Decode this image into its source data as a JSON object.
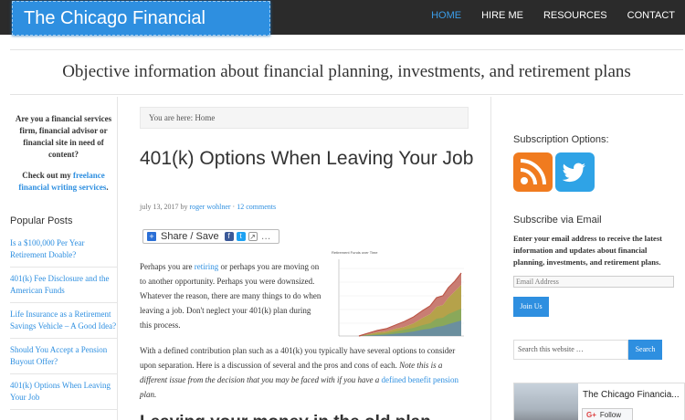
{
  "header": {
    "logo": "The Chicago Financial Planner",
    "nav": [
      "HOME",
      "HIRE ME",
      "RESOURCES",
      "CONTACT"
    ],
    "active_nav": "HOME",
    "tagline": "Objective information about financial planning, investments, and retirement plans"
  },
  "left_sidebar": {
    "promo_text": "Are you a financial services firm, financial advisor or financial site in need of content?",
    "promo_cta_prefix": "Check out my",
    "promo_cta_link": "freelance financial writing services",
    "promo_cta_suffix": ".",
    "popular_title": "Popular Posts",
    "popular_posts": [
      "Is a $100,000 Per Year Retirement Doable?",
      "401(k) Fee Disclosure and the American Funds",
      "Life Insurance as a Retirement Savings Vehicle – A Good Idea?",
      "Should You Accept a Pension Buyout Offer?",
      "401(k) Options When Leaving Your Job"
    ]
  },
  "main": {
    "breadcrumb": "You are here: Home",
    "post_title": "401(k) Options When Leaving Your Job",
    "meta_date": "july 13, 2017 by",
    "meta_author": "roger wohlner",
    "meta_sep": "·",
    "meta_comments": "12 comments",
    "share_label": "Share / Save",
    "p1_a": "Perhaps you are",
    "p1_link": "retiring",
    "p1_b": "or perhaps you are moving on to another opportunity. Perhaps you were downsized. Whatever the reason, there are many things to do when leaving a job. Don't neglect your 401(k) plan during this process.",
    "p2_a": "With a defined contribution plan such as a 401(k) you typically have several options to consider upon separation.  Here is a discussion of several and the pros and cons of each.",
    "p2_em": "Note this is a different issue from the decision that you may be faced with if you have a",
    "p2_link": "defined benefit pension",
    "p2_em_end": "plan.",
    "heading_partial": "Leaving your money in the old plan",
    "chart_title": "Retirement Funds over Time"
  },
  "right_sidebar": {
    "subscription_title": "Subscription Options:",
    "subscribe_title": "Subscribe via Email",
    "subscribe_desc": "Enter your email address to receive the latest information and updates about financial planning, investments, and retirement plans.",
    "email_placeholder": "Email Address",
    "join_label": "Join Us",
    "search_placeholder": "Search this website …",
    "search_button": "Search",
    "fb_name": "The Chicago Financia...",
    "fb_follow": "Follow"
  },
  "colors": {
    "accent": "#2e8fe0",
    "topbar": "#2b2b2b",
    "rss": "#f07b1f",
    "twitter": "#2fa3e6"
  }
}
